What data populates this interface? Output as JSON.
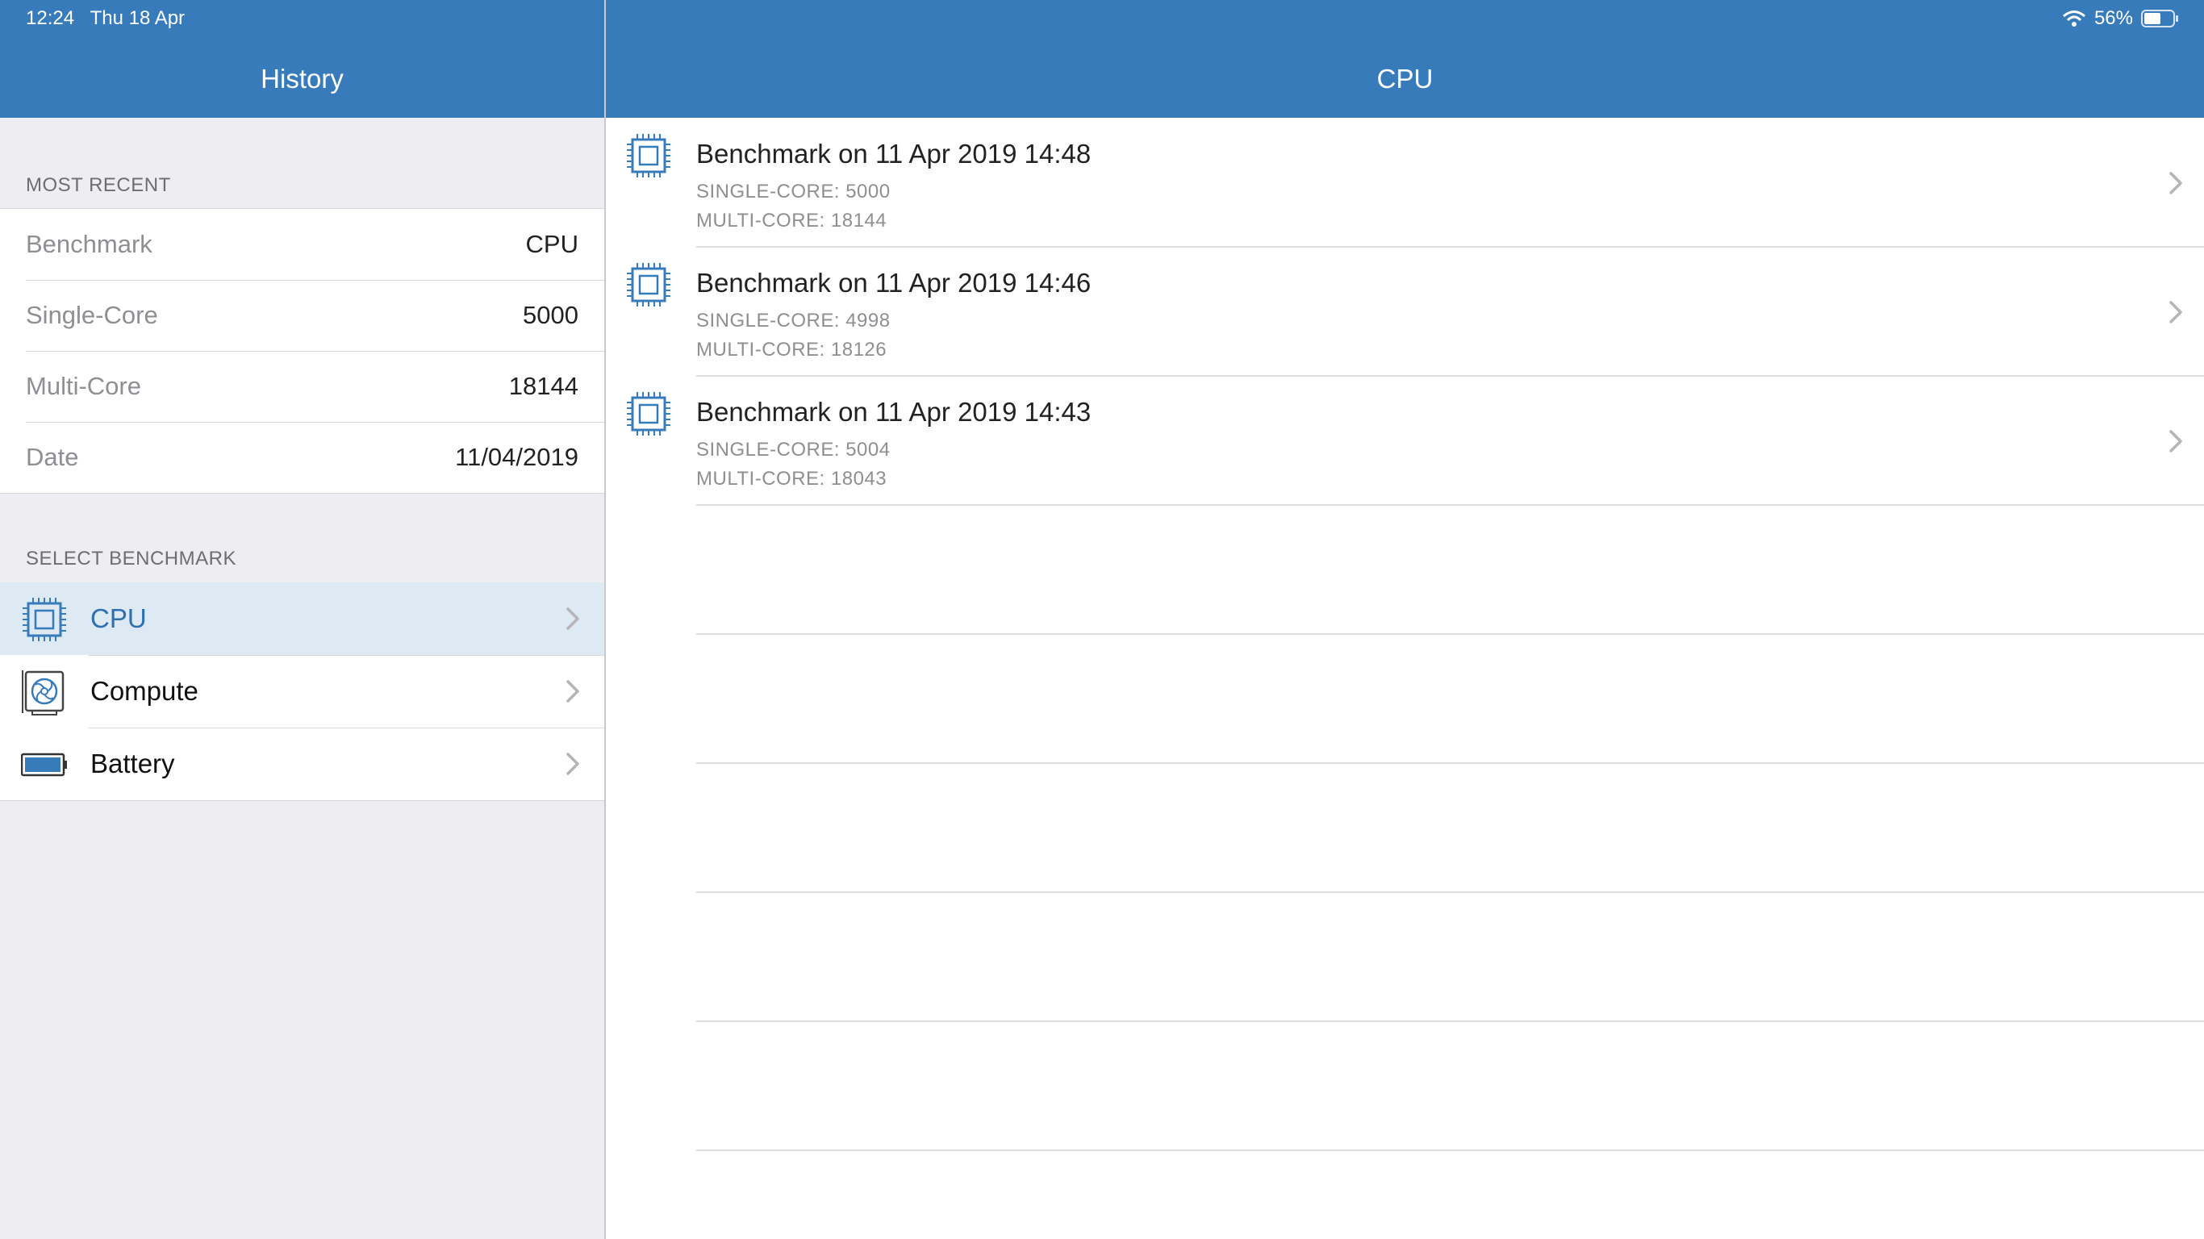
{
  "status_bar": {
    "time": "12:24",
    "date": "Thu 18 Apr",
    "battery_percent": "56%"
  },
  "left": {
    "title": "History",
    "most_recent": {
      "header": "MOST RECENT",
      "rows": [
        {
          "label": "Benchmark",
          "value": "CPU"
        },
        {
          "label": "Single-Core",
          "value": "5000"
        },
        {
          "label": "Multi-Core",
          "value": "18144"
        },
        {
          "label": "Date",
          "value": "11/04/2019"
        }
      ]
    },
    "select_benchmark": {
      "header": "SELECT BENCHMARK",
      "items": [
        {
          "label": "CPU",
          "icon": "cpu-chip-icon",
          "selected": true
        },
        {
          "label": "Compute",
          "icon": "gpu-card-icon",
          "selected": false
        },
        {
          "label": "Battery",
          "icon": "battery-icon",
          "selected": false
        }
      ]
    }
  },
  "right": {
    "title": "CPU",
    "results": [
      {
        "title": "Benchmark on 11 Apr 2019 14:48",
        "single": "SINGLE-CORE: 5000",
        "multi": "MULTI-CORE: 18144"
      },
      {
        "title": "Benchmark on 11 Apr 2019 14:46",
        "single": "SINGLE-CORE: 4998",
        "multi": "MULTI-CORE: 18126"
      },
      {
        "title": "Benchmark on 11 Apr 2019 14:43",
        "single": "SINGLE-CORE: 5004",
        "multi": "MULTI-CORE: 18043"
      }
    ]
  },
  "colors": {
    "accent": "#387bbb",
    "selected_row": "#dde9f3",
    "background": "#eeedf2"
  }
}
